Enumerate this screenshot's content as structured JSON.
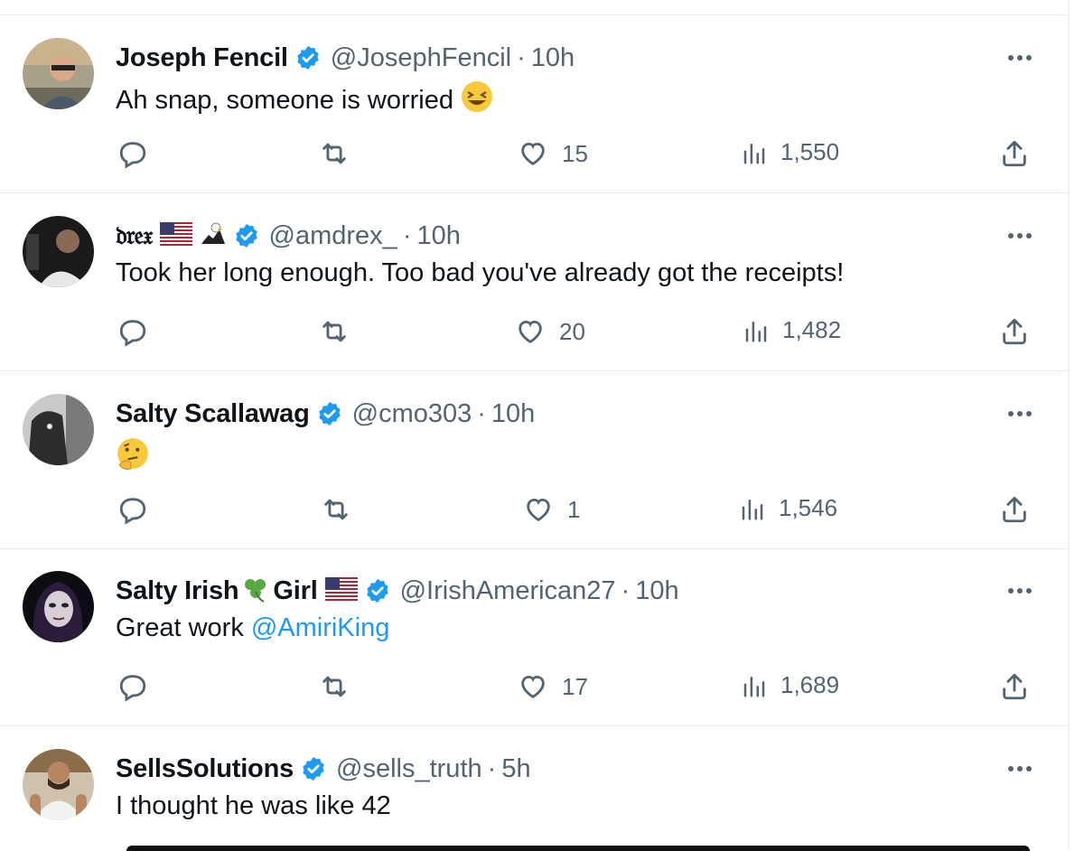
{
  "tweets": [
    {
      "display_name": "Joseph Fencil",
      "handle": "@JosephFencil",
      "separator": "·",
      "time": "10h",
      "text": "Ah snap, someone is worried",
      "emoji": "grinning-squinting-face",
      "likes": "15",
      "views": "1,550",
      "verified": true
    },
    {
      "display_name": "𝔡𝔯𝔢𝔵",
      "handle": "@amdrex_",
      "separator": "·",
      "time": "10h",
      "text": "Took her long enough. Too bad you've already got the receipts!",
      "name_extras": [
        "us-flag",
        "eagle"
      ],
      "likes": "20",
      "views": "1,482",
      "verified": true
    },
    {
      "display_name": "Salty Scallawag",
      "handle": "@cmo303",
      "separator": "·",
      "time": "10h",
      "text": "",
      "emoji": "thinking-face",
      "likes": "1",
      "views": "1,546",
      "verified": true
    },
    {
      "display_name_part1": "Salty Irish",
      "display_name_part2": "Girl",
      "name_extras": [
        "shamrock",
        "us-flag"
      ],
      "handle": "@IrishAmerican27",
      "separator": "·",
      "time": "10h",
      "text": "Great work",
      "mention": "@AmiriKing",
      "likes": "17",
      "views": "1,689",
      "verified": true
    },
    {
      "display_name": "SellsSolutions",
      "handle": "@sells_truth",
      "separator": "·",
      "time": "5h",
      "text": "I thought he was like 42",
      "verified": true
    }
  ],
  "icons": {
    "reply": "reply-icon",
    "retweet": "retweet-icon",
    "like": "heart-icon",
    "views": "views-icon",
    "share": "share-icon",
    "more": "more-icon",
    "verified": "verified-badge-icon"
  },
  "colors": {
    "text": "#0f1419",
    "secondary": "#536471",
    "accent": "#1d9bf0",
    "divider": "#e6ecf0"
  }
}
